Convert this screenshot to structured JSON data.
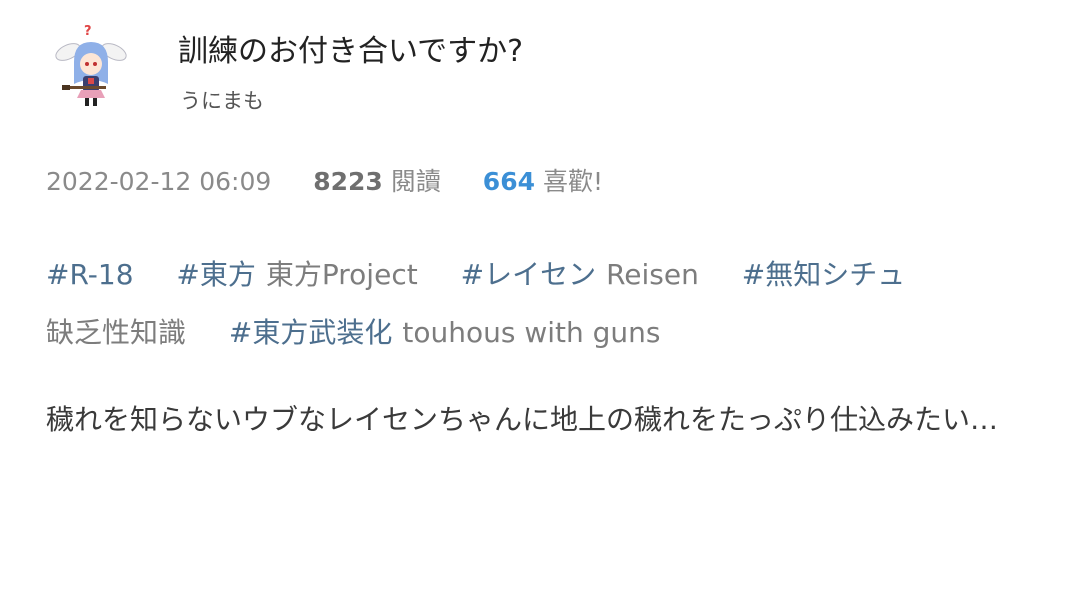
{
  "work": {
    "title": "訓練のお付き合いですか?",
    "author": "うにまも"
  },
  "meta": {
    "date": "2022-02-12 06:09",
    "views_count": "8223",
    "views_label": "閱讀",
    "likes_count": "664",
    "likes_label": "喜歡!"
  },
  "tags": [
    {
      "name": "#R-18",
      "translation": ""
    },
    {
      "name": "#東方",
      "translation": "東方Project"
    },
    {
      "name": "#レイセン",
      "translation": "Reisen"
    },
    {
      "name": "#無知シチュ",
      "translation": "缺乏性知識"
    },
    {
      "name": "#東方武装化",
      "translation": "touhous with guns"
    }
  ],
  "caption": "穢れを知らないウブなレイセンちゃんに地上の穢れをたっぷり仕込みたい…",
  "colors": {
    "tag": "#4d6f8e",
    "likes": "#3b8fd6",
    "text": "#3a3a3a",
    "muted": "#8a8a8a"
  }
}
